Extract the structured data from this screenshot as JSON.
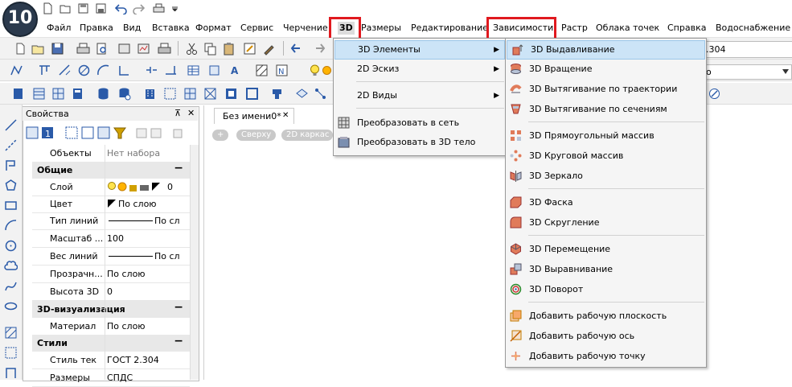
{
  "app": {
    "logo_text": "10"
  },
  "menubar": {
    "items": [
      {
        "label": "Файл"
      },
      {
        "label": "Правка"
      },
      {
        "label": "Вид"
      },
      {
        "label": "Вставка"
      },
      {
        "label": "Формат"
      },
      {
        "label": "Сервис"
      },
      {
        "label": "Черчение"
      },
      {
        "label": "3D"
      },
      {
        "label": "Размеры"
      },
      {
        "label": "Редактирование"
      },
      {
        "label": "Зависимости"
      },
      {
        "label": "Растр"
      },
      {
        "label": "Облака точек"
      },
      {
        "label": "Справка"
      },
      {
        "label": "Водоснабжение"
      }
    ],
    "highlight_color": "#e0191f"
  },
  "toolbar": {
    "style_value": ".304",
    "layer_value": "о"
  },
  "properties": {
    "title": "Свойства",
    "pin": "⊼",
    "close": "✕",
    "objects_label": "Объекты",
    "objects_value": "Нет набора",
    "groups": {
      "general": "Общие",
      "vis3d": "3D-визуализация",
      "styles": "Стили"
    },
    "rows": {
      "layer": {
        "label": "Слой",
        "value": "0"
      },
      "color": {
        "label": "Цвет",
        "value": "По слою"
      },
      "linetype": {
        "label": "Тип линий",
        "value": "По сл"
      },
      "scale": {
        "label": "Масштаб ...",
        "value": "100"
      },
      "lineweight": {
        "label": "Вес линий",
        "value": "По сл"
      },
      "transparency": {
        "label": "Прозрачн...",
        "value": "По слою"
      },
      "height3d": {
        "label": "Высота 3D",
        "value": "0"
      },
      "material": {
        "label": "Материал",
        "value": "По слою"
      },
      "textstyle": {
        "label": "Стиль тек",
        "value": "ГОСТ 2.304"
      },
      "dimstyle": {
        "label": "Размеры",
        "value": "СПДС"
      }
    },
    "collapse_symbol": "−"
  },
  "document": {
    "tab_title": "Без имени0*",
    "tab_close": "✕",
    "view_pills": [
      "+",
      "Сверху",
      "2D каркас"
    ]
  },
  "menu3d": {
    "items": [
      {
        "label": "3D Элементы",
        "submenu": true
      },
      {
        "label": "2D Эскиз",
        "submenu": true
      },
      {
        "label": "2D Виды",
        "submenu": true
      },
      {
        "label": "Преобразовать в сеть",
        "submenu": false
      },
      {
        "label": "Преобразовать в 3D тело",
        "submenu": false
      }
    ],
    "arrow": "▶"
  },
  "submenu_elements": {
    "items": [
      "3D Выдавливание",
      "3D Вращение",
      "3D Вытягивание по траектории",
      "3D Вытягивание по сечениям",
      "3D Прямоугольный массив",
      "3D Круговой массив",
      "3D Зеркало",
      "3D Фаска",
      "3D Скругление",
      "3D Перемещение",
      "3D Выравнивание",
      "3D Поворот",
      "Добавить рабочую плоскость",
      "Добавить рабочую ось",
      "Добавить рабочую точку"
    ]
  }
}
